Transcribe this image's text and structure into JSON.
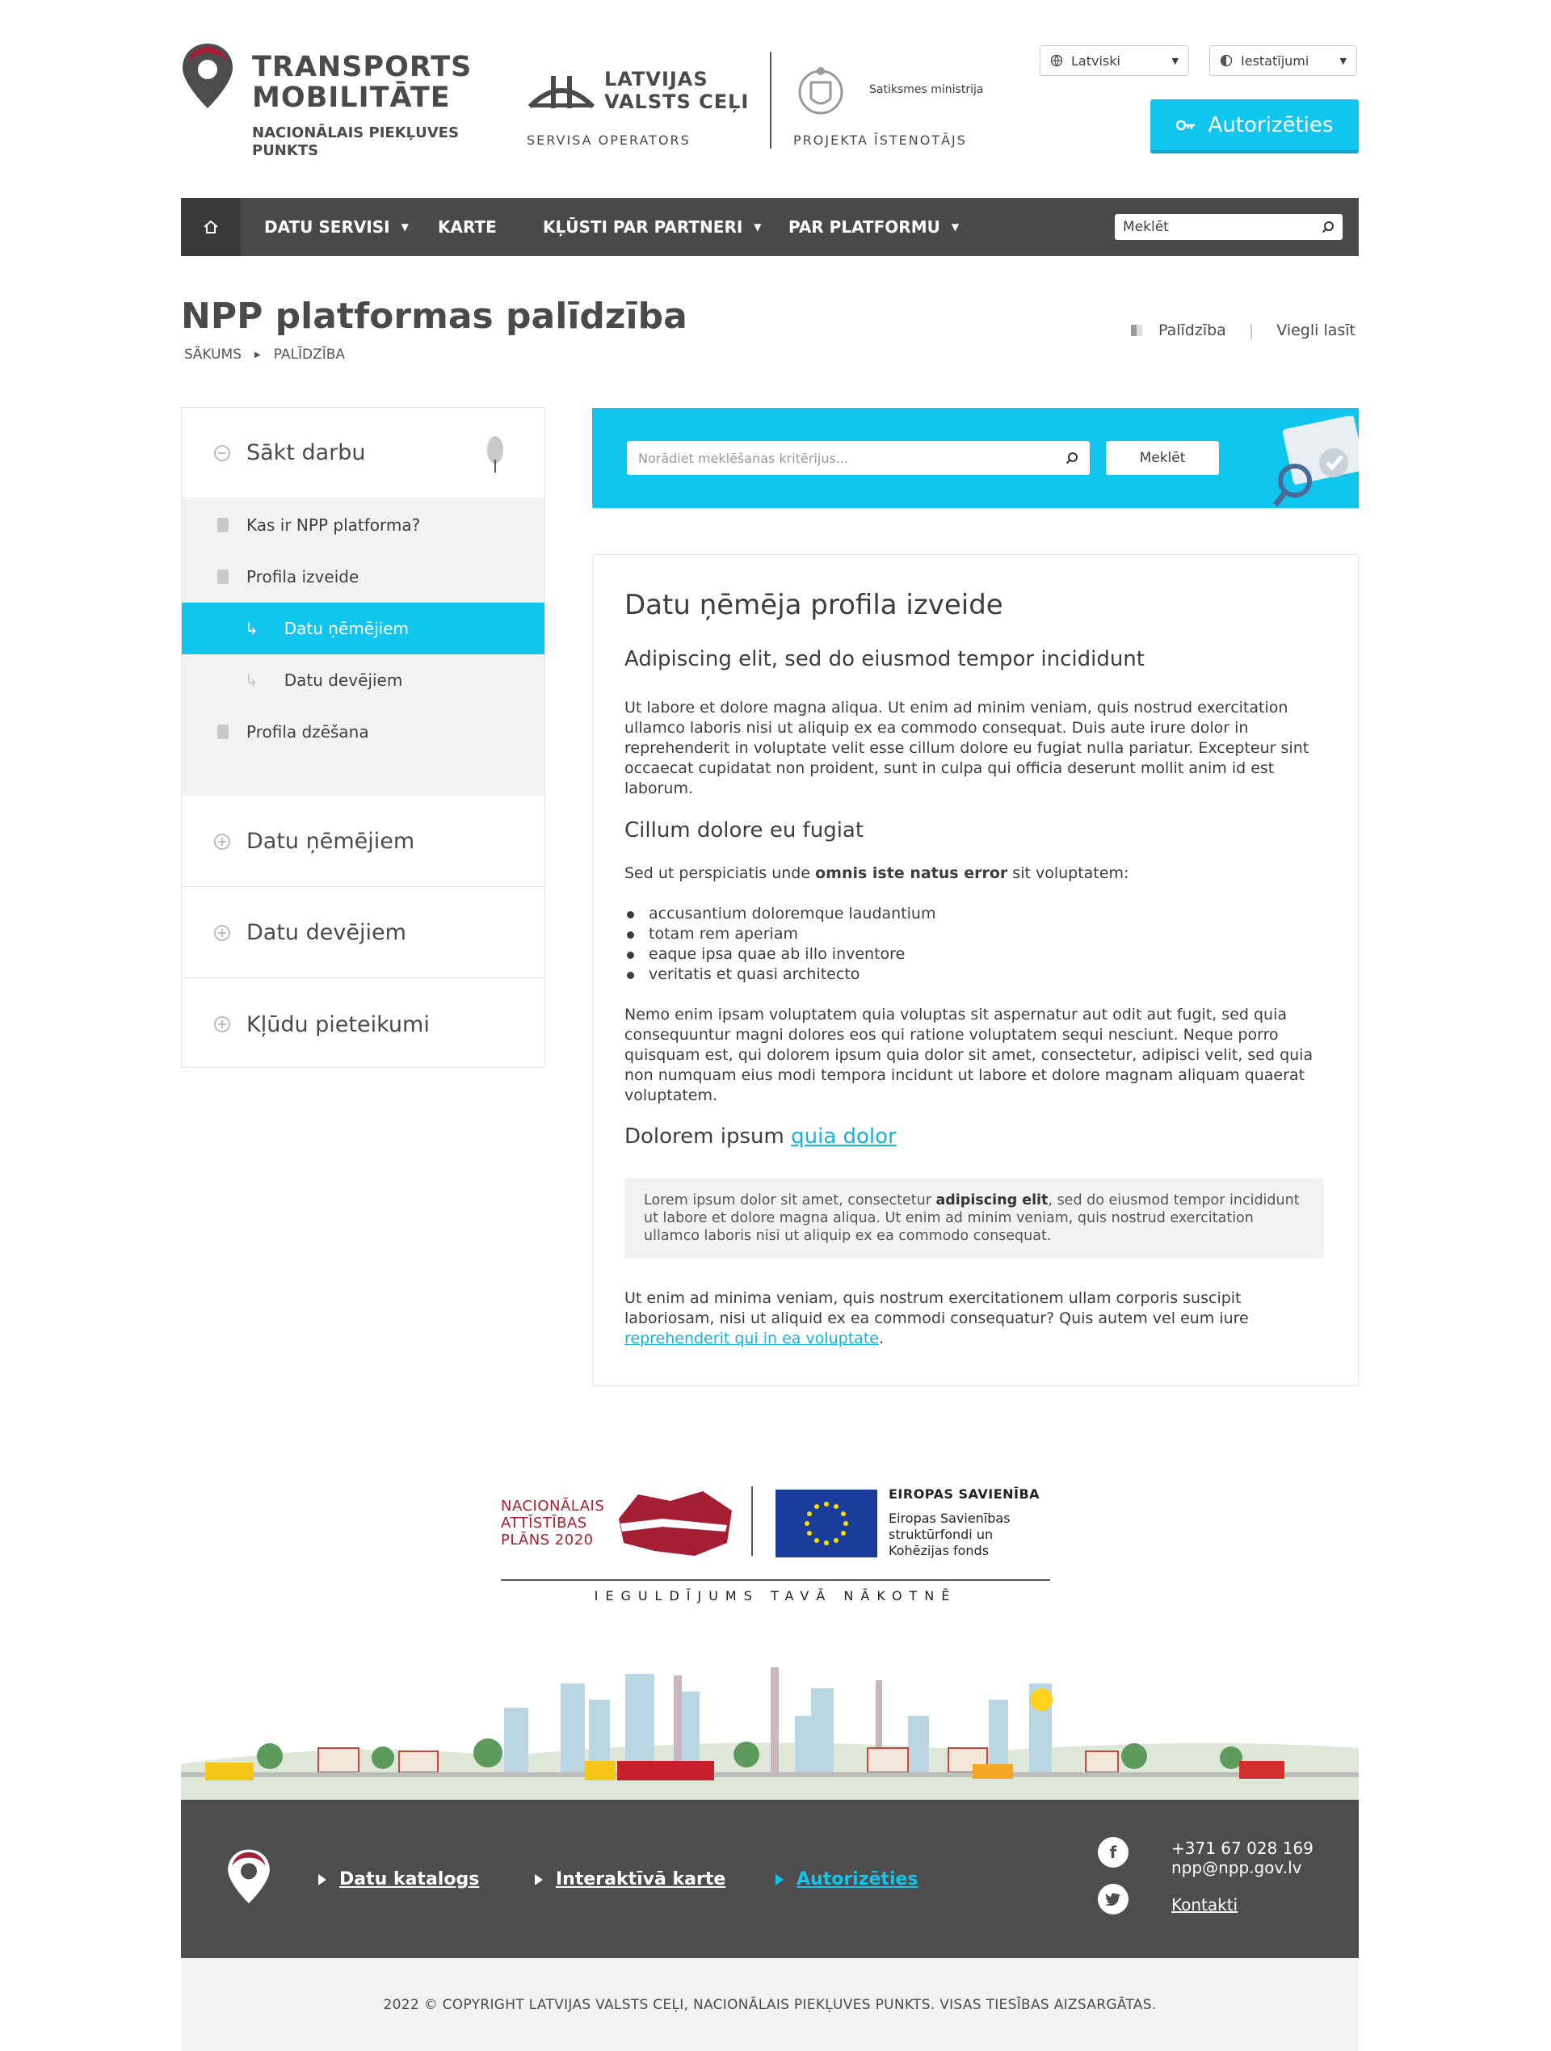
{
  "header": {
    "brand_title": "TRANSPORTS MOBILITĀTE",
    "brand_subtitle": "NACIONĀLAIS PIEKĻUVES PUNKTS",
    "operator_name": "LATVIJAS VALSTS CEĻI",
    "operator_caption": "SERVISA OPERATORS",
    "ministry_name": "Satiksmes ministrija",
    "ministry_caption": "PROJEKTA ĪSTENOTĀJS",
    "language": "Latviski",
    "settings": "Iestatījumi",
    "auth_button": "Autorizēties",
    "brand_color": "#10c6ef"
  },
  "nav": {
    "home_icon": "home-icon",
    "items": [
      {
        "label": "DATU SERVISI",
        "has_dropdown": true
      },
      {
        "label": "KARTE",
        "has_dropdown": false
      },
      {
        "label": "KĻŪSTI PAR PARTNERI",
        "has_dropdown": true
      },
      {
        "label": "PAR PLATFORMU",
        "has_dropdown": true
      }
    ],
    "search_placeholder": "Meklēt"
  },
  "page": {
    "title": "NPP platformas palīdzība",
    "breadcrumb": [
      "SĀKUMS",
      "PALĪDZĪBA"
    ],
    "tool_help": "Palīdzība",
    "tool_easy_read": "Viegli lasīt"
  },
  "sidebar": {
    "sections": [
      {
        "label": "Sākt darbu",
        "expanded": true
      },
      {
        "label": "Datu ņēmējiem",
        "expanded": false
      },
      {
        "label": "Datu devējiem",
        "expanded": false
      },
      {
        "label": "Kļūdu pieteikumi",
        "expanded": false
      }
    ],
    "items": [
      {
        "label": "Kas ir NPP platforma?"
      },
      {
        "label": "Profila izveide"
      },
      {
        "label": "Datu ņēmējiem",
        "active": true
      },
      {
        "label": "Datu devējiem"
      },
      {
        "label": "Profila dzēšana"
      }
    ]
  },
  "search": {
    "placeholder": "Norādiet meklēšanas kritērijus...",
    "button": "Meklēt"
  },
  "article": {
    "title": "Datu ņēmēja profila izveide",
    "h2_1": "Adipiscing elit, sed do eiusmod tempor incididunt",
    "p1": "Ut labore et dolore magna aliqua. Ut enim ad minim veniam, quis nostrud exercitation ullamco laboris nisi ut aliquip ex ea commodo consequat. Duis aute irure dolor in reprehenderit in voluptate velit esse cillum dolore eu fugiat nulla pariatur. Excepteur sint occaecat cupidatat non proident, sunt in culpa qui officia deserunt mollit anim id est laborum.",
    "h2_2": "Cillum dolore eu fugiat",
    "p2_before": "Sed ut perspiciatis unde ",
    "p2_bold": "omnis iste natus error",
    "p2_after": " sit voluptatem:",
    "list": [
      "accusantium doloremque laudantium",
      "totam rem aperiam",
      "eaque ipsa quae ab illo inventore",
      "veritatis et quasi architecto"
    ],
    "p3": "Nemo enim ipsam voluptatem quia voluptas sit aspernatur aut odit aut fugit, sed quia consequuntur magni dolores eos qui ratione voluptatem sequi nesciunt. Neque porro quisquam est, qui dolorem ipsum quia dolor sit amet, consectetur, adipisci velit, sed quia non numquam eius modi tempora incidunt ut labore et dolore magnam aliquam quaerat voluptatem.",
    "h2_3_text": "Dolorem ipsum ",
    "h2_3_link": "quia dolor",
    "quote_before": "Lorem ipsum dolor sit amet, consectetur ",
    "quote_bold": "adipiscing elit",
    "quote_after": ", sed do eiusmod tempor incididunt ut labore et dolore magna aliqua. Ut enim ad minim veniam, quis nostrud exercitation ullamco laboris nisi ut aliquip ex ea commodo consequat.",
    "p4": "Ut enim ad minima veniam, quis nostrum exercitationem ullam corporis suscipit laboriosam, nisi ut aliquid ex ea commodi consequatur? Quis autem vel eum iure ",
    "p4_link": "reprehenderit qui in ea voluptate",
    "p4_end": "."
  },
  "funding": {
    "nap_text": "NACIONĀLAIS ATTĪSTĪBAS PLĀNS 2020",
    "eu_title": "EIROPAS SAVIENĪBA",
    "eu_text": "Eiropas Savienības struktūrfondi un Kohēzijas fonds",
    "motto": "IEGULDĪJUMS TAVĀ NĀKOTNĒ"
  },
  "footer": {
    "links": [
      {
        "label": "Datu katalogs",
        "highlight": false
      },
      {
        "label": "Interaktīvā karte",
        "highlight": false
      },
      {
        "label": "Autorizēties",
        "highlight": true
      }
    ],
    "phone": "+371 67 028 169",
    "email": "npp@npp.gov.lv",
    "contacts": "Kontakti",
    "copyright": "2022 © COPYRIGHT LATVIJAS VALSTS CEĻI, NACIONĀLAIS PIEKĻUVES PUNKTS. VISAS TIESĪBAS AIZSARGĀTAS."
  }
}
